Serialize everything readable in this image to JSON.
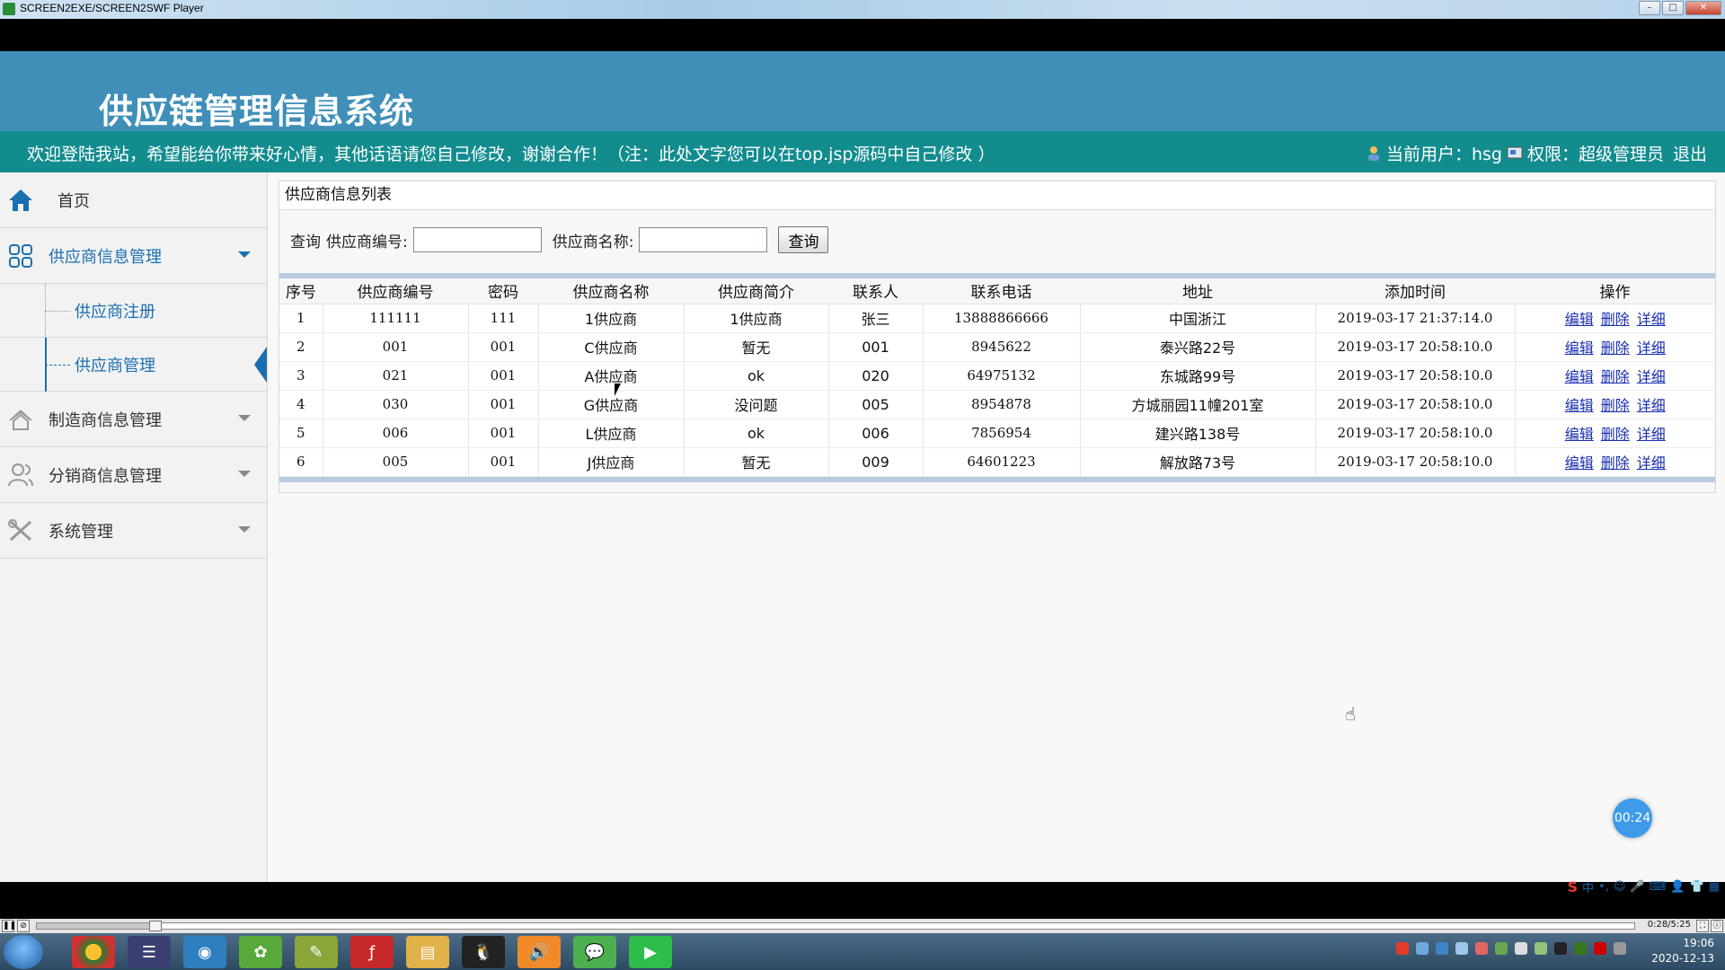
{
  "window": {
    "title": "SCREEN2EXE/SCREEN2SWF Player"
  },
  "header": {
    "system_title": "供应链管理信息系统",
    "welcome": "欢迎登陆我站，希望能给你带来好心情，其他话语请您自己修改，谢谢合作！（注：此处文字您可以在top.jsp源码中自己修改 ）",
    "current_user": "当前用户：hsg",
    "permission": "权限：超级管理员",
    "logout": "退出"
  },
  "sidebar": {
    "home": "首页",
    "groups": [
      {
        "label": "供应商信息管理",
        "items": [
          "供应商注册",
          "供应商管理"
        ]
      },
      {
        "label": "制造商信息管理"
      },
      {
        "label": "分销商信息管理"
      },
      {
        "label": "系统管理"
      }
    ]
  },
  "panel": {
    "title": "供应商信息列表",
    "query_label": "查询",
    "supplier_no_label": "供应商编号:",
    "supplier_no_value": "",
    "supplier_name_label": "供应商名称:",
    "supplier_name_value": "",
    "search_button": "查询"
  },
  "table": {
    "columns": [
      "序号",
      "供应商编号",
      "密码",
      "供应商名称",
      "供应商简介",
      "联系人",
      "联系电话",
      "地址",
      "添加时间",
      "操作"
    ],
    "rows": [
      [
        "1",
        "111111",
        "111",
        "1供应商",
        "1供应商",
        "张三",
        "13888866666",
        "中国浙江",
        "2019-03-17 21:37:14.0"
      ],
      [
        "2",
        "001",
        "001",
        "C供应商",
        "暂无",
        "001",
        "8945622",
        "泰兴路22号",
        "2019-03-17 20:58:10.0"
      ],
      [
        "3",
        "021",
        "001",
        "A供应商",
        "ok",
        "020",
        "64975132",
        "东城路99号",
        "2019-03-17 20:58:10.0"
      ],
      [
        "4",
        "030",
        "001",
        "G供应商",
        "没问题",
        "005",
        "8954878",
        "方城丽园11幢201室",
        "2019-03-17 20:58:10.0"
      ],
      [
        "5",
        "006",
        "001",
        "L供应商",
        "ok",
        "006",
        "7856954",
        "建兴路138号",
        "2019-03-17 20:58:10.0"
      ],
      [
        "6",
        "005",
        "001",
        "J供应商",
        "暂无",
        "009",
        "64601223",
        "解放路73号",
        "2019-03-17 20:58:10.0"
      ]
    ],
    "actions": [
      "编辑",
      "删除",
      "详细"
    ]
  },
  "player": {
    "timer": "00:24",
    "time_readout": "0:28/5:25",
    "progress": 0.074
  },
  "taskbar": {
    "time": "19:06",
    "date": "2020-12-13"
  },
  "ime": {
    "mode": "中"
  },
  "colors": {
    "header_blue": "#3f8fb8",
    "header_teal": "#138c8e",
    "link_blue": "#1a2fb0",
    "sidebar_active": "#1a6fb0"
  }
}
